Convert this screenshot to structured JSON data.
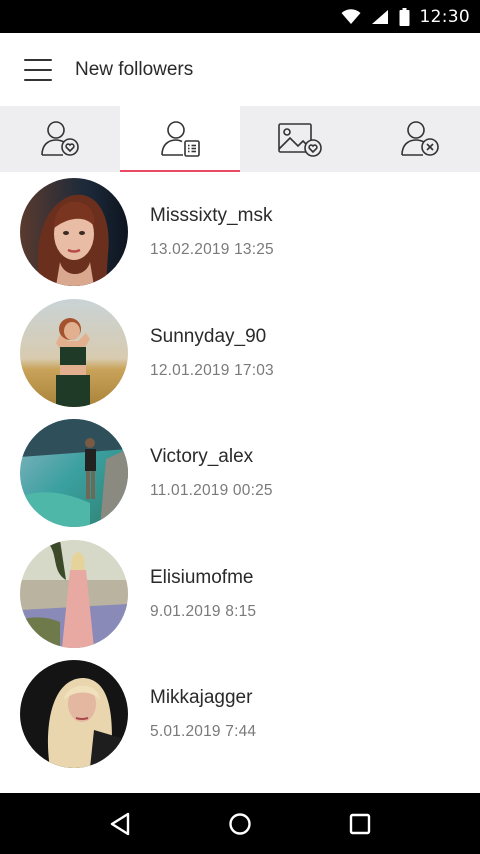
{
  "status_bar": {
    "time": "12:30"
  },
  "app_bar": {
    "title": "New followers"
  },
  "tabs": [
    {
      "id": "followers",
      "icon": "user-heart-icon",
      "active": false
    },
    {
      "id": "list",
      "icon": "user-list-icon",
      "active": true
    },
    {
      "id": "photos",
      "icon": "photo-heart-icon",
      "active": false
    },
    {
      "id": "unfollowers",
      "icon": "user-remove-icon",
      "active": false
    }
  ],
  "followers": [
    {
      "name": "Misssixty_msk",
      "date": "13.02.2019 13:25"
    },
    {
      "name": "Sunnyday_90",
      "date": "12.01.2019 17:03"
    },
    {
      "name": "Victory_alex",
      "date": "11.01.2019 00:25"
    },
    {
      "name": "Elisiumofme",
      "date": "9.01.2019 8:15"
    },
    {
      "name": "Mikkajagger",
      "date": "5.01.2019 7:44"
    }
  ],
  "colors": {
    "accent": "#e94b64",
    "tab_bg": "#eeeef0",
    "icon": "#333333"
  }
}
